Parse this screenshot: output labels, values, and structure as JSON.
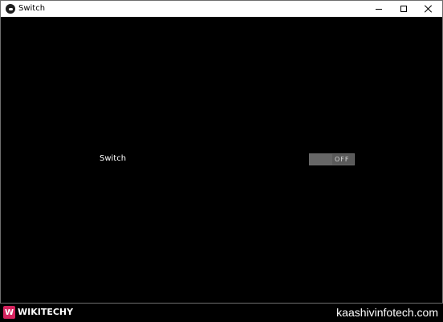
{
  "window": {
    "title": "Switch",
    "controls": [
      "minimize",
      "maximize",
      "close"
    ]
  },
  "main": {
    "switch_label": "Switch",
    "switch_state": "OFF"
  },
  "footer": {
    "logo_mark": "W",
    "brand": "WIKITECHY",
    "website": "kaashivinfotech.com"
  },
  "colors": {
    "background": "#000000",
    "titlebar": "#ffffff",
    "switch_track": "#5a5a5a",
    "switch_thumb": "#666666",
    "logo_accent": "#d6245f"
  },
  "icons": {
    "app": "app-icon",
    "minimize": "minimize-icon",
    "maximize": "maximize-icon",
    "close": "close-icon"
  }
}
